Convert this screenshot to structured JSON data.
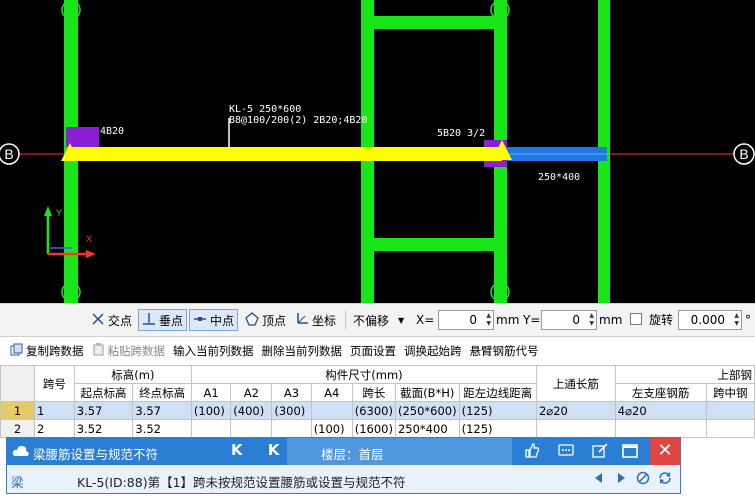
{
  "cad": {
    "axis_label_left": "B",
    "axis_label_right": "B",
    "beam_label_line1": "KL-5 250*600",
    "beam_label_line2": "B8@100/200(2) 2B20;4B20",
    "left_top_rebar": "4B20",
    "right_top_rebar": "5B20 3/2",
    "right_span_size": "250*400",
    "ucs_y": "Y",
    "ucs_x": "X",
    "colors": {
      "column": "#19e619",
      "beam": "#ffff00",
      "beam_right": "#1e78e0",
      "support": "#8a1fd6",
      "axis": "#ff3030",
      "background": "#000000"
    }
  },
  "snapbar": {
    "intersection": "交点",
    "perpendicular": "垂点",
    "midpoint": "中点",
    "vertex": "顶点",
    "coordinate": "坐标",
    "offset_mode": "不偏移",
    "x_label": "X=",
    "x_value": "0",
    "x_unit": "mm",
    "y_label": "Y=",
    "y_value": "0",
    "y_unit": "mm",
    "rotate_label": "旋转",
    "rotate_value": "0.000",
    "degree": "°"
  },
  "table_toolbar": {
    "copy_span": "复制跨数据",
    "paste_span": "粘贴跨数据",
    "input_column": "输入当前列数据",
    "delete_column": "删除当前列数据",
    "page_setup": "页面设置",
    "swap_start": "调换起始跨",
    "cantilever_code": "悬臂钢筋代号"
  },
  "grid": {
    "headers": {
      "span_no": "跨号",
      "elevation": "标高(m)",
      "start_elev": "起点标高",
      "end_elev": "终点标高",
      "member_size": "构件尺寸(mm)",
      "a1": "A1",
      "a2": "A2",
      "a3": "A3",
      "a4": "A4",
      "span_len": "跨长",
      "section": "截面(B*H)",
      "left_edge": "距左边线距离",
      "top_through": "上通长筋",
      "top_group": "上部钢",
      "left_support": "左支座钢筋",
      "mid_span": "跨中钢"
    },
    "rows": [
      {
        "rn": "1",
        "span": "1",
        "start": "3.57",
        "end": "3.57",
        "a1": "(100)",
        "a2": "(400)",
        "a3": "(300)",
        "a4": "",
        "len": "(6300)",
        "sec": "(250*600)",
        "dist": "(125)",
        "through": "2⌀20",
        "left": "4⌀20",
        "mid": ""
      },
      {
        "rn": "2",
        "span": "2",
        "start": "3.52",
        "end": "3.52",
        "a1": "",
        "a2": "",
        "a3": "",
        "a4": "(100)",
        "len": "(1600)",
        "sec": "250*400",
        "dist": "(125)",
        "through": "",
        "left": "",
        "mid": ""
      }
    ]
  },
  "notify": {
    "title": "梁腰筋设置与规范不符",
    "nav": "K K",
    "floor": "楼层：首层",
    "category": "梁",
    "message": "KL-5(ID:88)第【1】跨未按规范设置腰筋或设置与规范不符",
    "close": "✕"
  }
}
